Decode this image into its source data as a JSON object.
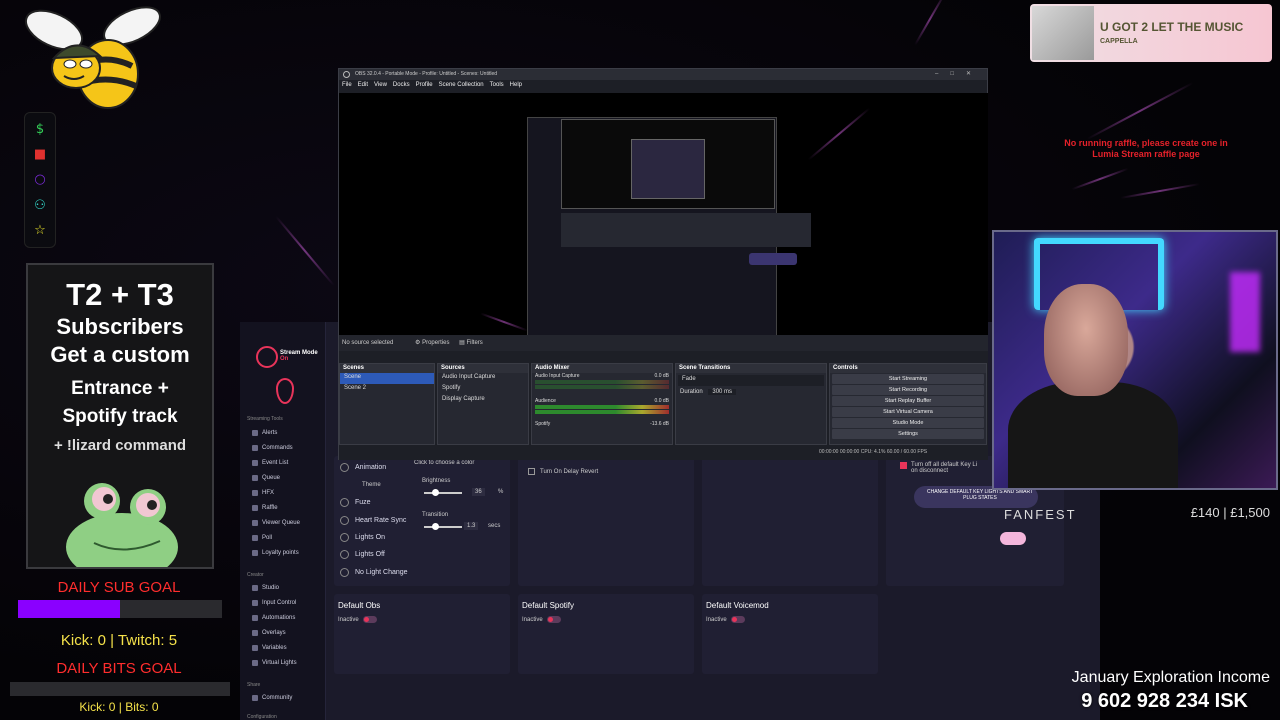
{
  "music": {
    "title": "U GOT 2 LET THE MUSIC",
    "artist": "CAPPELLA"
  },
  "raffle_msg": "No running raffle, please create one in Lumia Stream raffle page",
  "icons": [
    "dollar-icon",
    "gamepad-icon",
    "circle-icon",
    "add-user-icon",
    "star-icon"
  ],
  "sub_panel": {
    "line1": "T2 + T3",
    "line2": "Subscribers",
    "line3": "Get a custom",
    "line4": "Entrance +",
    "line5": "Spotify track",
    "line6": "+ !lizard command"
  },
  "sub_goal": {
    "title": "DAILY SUB GOAL",
    "progress": 0.5,
    "count": "Kick: 0 | Twitch: 5"
  },
  "bits_goal": {
    "title": "DAILY BITS GOAL",
    "progress": 0,
    "count": "Kick: 0 | Bits: 0"
  },
  "obs": {
    "title": "OBS 32.0.4 - Portable Mode - Profile: Untitled - Scenes: Untitled",
    "menu": [
      "File",
      "Edit",
      "View",
      "Docks",
      "Profile",
      "Scene Collection",
      "Tools",
      "Help"
    ],
    "toolbar": {
      "no_source": "No source selected",
      "properties": "Properties",
      "filters": "Filters"
    },
    "scenes": {
      "header": "Scenes",
      "items": [
        "Scene",
        "Scene 2"
      ]
    },
    "sources": {
      "header": "Sources",
      "items": [
        "Audio Input Capture",
        "Spotify",
        "Display Capture"
      ]
    },
    "mixer": {
      "header": "Audio Mixer",
      "ch1": "Audio Input Capture",
      "ch1_db": "0.0 dB",
      "ch2": "Audience",
      "ch2_db": "0.0 dB",
      "ch3": "Spotify",
      "ch3_db": "-13.6 dB"
    },
    "transitions": {
      "header": "Scene Transitions",
      "type": "Fade",
      "duration_label": "Duration",
      "duration": "300 ms"
    },
    "controls": {
      "header": "Controls",
      "buttons": [
        "Start Streaming",
        "Start Recording",
        "Start Replay Buffer",
        "Start Virtual Camera",
        "Studio Mode",
        "Settings"
      ]
    },
    "status": "CPU: 4.1%   60.00 / 60.00 FPS",
    "time1": "00:00:00",
    "time2": "00:00:00"
  },
  "lumia": {
    "stream_mode": "Stream Mode",
    "stream_on": "On",
    "sec_tools": "Streaming Tools",
    "tools": [
      "Alerts",
      "Commands",
      "Event List",
      "Queue",
      "HFX",
      "Raffle",
      "Viewer Queue",
      "Poll",
      "Loyalty points"
    ],
    "sec_creator": "Creator",
    "creator": [
      "Studio",
      "Input Control",
      "Automations",
      "Overlays",
      "Variables",
      "Virtual Lights"
    ],
    "sec_share": "Share",
    "share": [
      "Community"
    ],
    "sec_config": "Configuration",
    "options": [
      "Animation",
      "Fuze",
      "Heart Rate Sync",
      "Lights On",
      "Lights Off",
      "No Light Change"
    ],
    "theme": "Theme",
    "color_hint": "Click to choose a color",
    "brightness_label": "Brightness",
    "brightness_value": "36",
    "brightness_unit": "%",
    "transition_label": "Transition",
    "transition_value": "1.3",
    "transition_unit": "secs",
    "delay_revert": "Turn On Delay Revert",
    "turn_off": "Turn off all default Key Li",
    "turn_off2": "on disconnect",
    "change_btn": "CHANGE DEFAULT KEY LIGHTS AND SMART PLUG STATES",
    "cards": [
      {
        "title": "Default Obs",
        "state": "Inactive"
      },
      {
        "title": "Default Spotify",
        "state": "Inactive"
      },
      {
        "title": "Default Voicemod",
        "state": "Inactive"
      }
    ]
  },
  "fanfest": "FANFEST",
  "money": "£140 | £1,500",
  "income": {
    "label": "January Exploration Income",
    "value": "9 602 928 234 ISK"
  }
}
